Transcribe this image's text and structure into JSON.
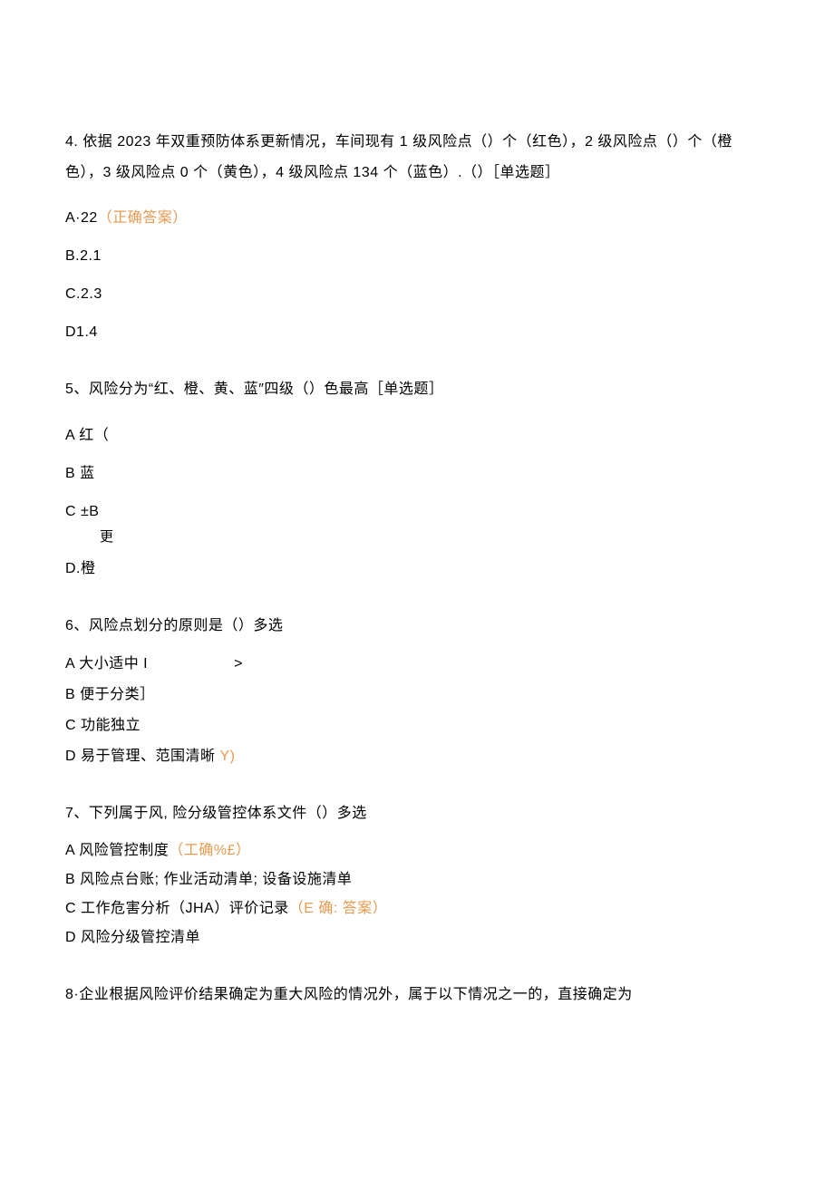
{
  "q4": {
    "stem": "4. 依据 2023 年双重预防体系更新情况，车间现有 1 级风险点（）个（红色），2 级风险点（）个（橙色），3 级风险点 0 个（黄色），4 级风险点 134 个（蓝色）.（）［单选题］",
    "optA": "A·22（正确答案）",
    "optB": "B.2.1",
    "optC": "C.2.3",
    "optD": "D1.4"
  },
  "q5": {
    "stem": "5、风险分为“红、橙、黄、蓝″四级（）色最高［单选题］",
    "optA": "A 红（",
    "optB": "B 蓝",
    "optC": "C ±B",
    "hint": "更",
    "optD": "D.橙"
  },
  "q6": {
    "stem": "6、风险点划分的原则是（）多选",
    "optA_pre": "A 大小适中 I",
    "optA_gt": ">",
    "optB": "B 便于分类］",
    "optC": "C 功能独立",
    "optD_pre": "D 易于管理、范围清晰 ",
    "optD_mark": "Y)"
  },
  "q7": {
    "stem": "7、下列属于风, 险分级管控体系文件（）多选",
    "optA_pre": "A 风险管控制度",
    "optA_mark": "（工确%£）",
    "optB": "B 风险点台账; 作业活动清单; 设备设施清单",
    "optC_pre": "C 工作危害分析（JHA）评价记录",
    "optC_mark": "（E 确: 答案）",
    "optD": "D 风险分级管控清单"
  },
  "q8": {
    "stem": "8·企业根据风险评价结果确定为重大风险的情况外，属于以下情况之一的，直接确定为"
  }
}
